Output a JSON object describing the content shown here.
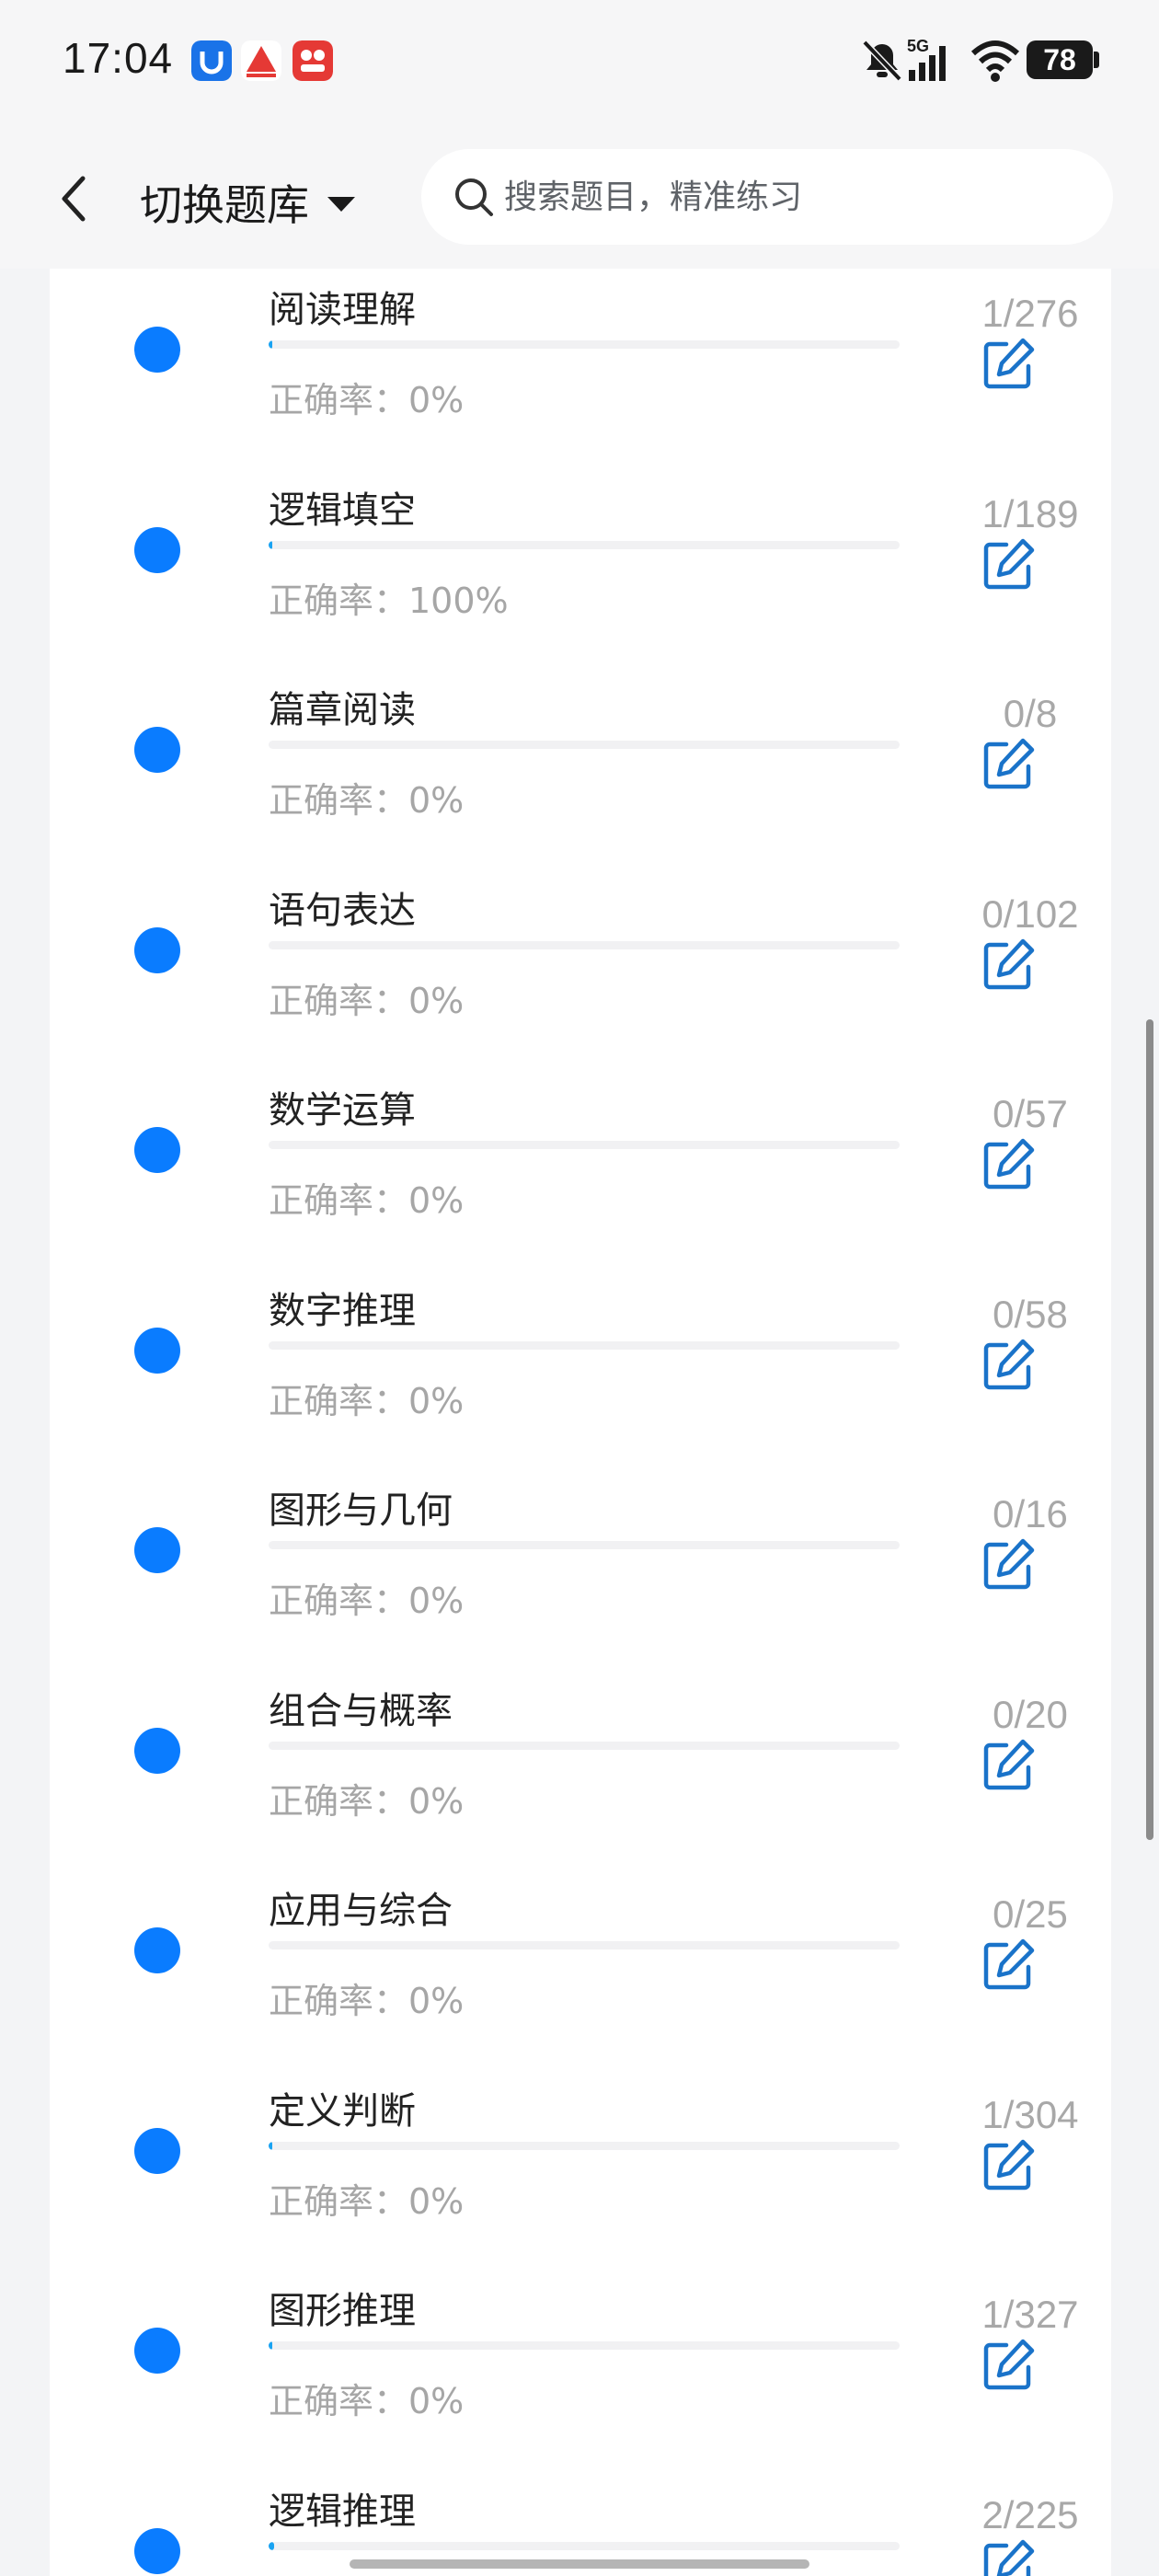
{
  "status_bar": {
    "time": "17:04",
    "network": "5G",
    "battery": "78",
    "icons": [
      "app-icon-blue",
      "app-icon-red-triangle",
      "app-icon-red-square",
      "bell-off-icon",
      "signal-icon",
      "wifi-icon"
    ]
  },
  "header": {
    "back_icon": "chevron-left-icon",
    "switch_label": "切换题库",
    "search_placeholder": "搜索题目，精准练习"
  },
  "accuracy_prefix": "正确率：",
  "colors": {
    "accent": "#0a7cff",
    "progress": "#1aa3f2",
    "edit_icon": "#1a73c9"
  },
  "items": [
    {
      "title": "阅读理解",
      "accuracy": "正确率：0%",
      "count": "1/276",
      "progress": 0.0036
    },
    {
      "title": "逻辑填空",
      "accuracy": "正确率：100%",
      "count": "1/189",
      "progress": 0.0053
    },
    {
      "title": "篇章阅读",
      "accuracy": "正确率：0%",
      "count": "0/8",
      "progress": 0
    },
    {
      "title": "语句表达",
      "accuracy": "正确率：0%",
      "count": "0/102",
      "progress": 0
    },
    {
      "title": "数学运算",
      "accuracy": "正确率：0%",
      "count": "0/57",
      "progress": 0
    },
    {
      "title": "数字推理",
      "accuracy": "正确率：0%",
      "count": "0/58",
      "progress": 0
    },
    {
      "title": "图形与几何",
      "accuracy": "正确率：0%",
      "count": "0/16",
      "progress": 0
    },
    {
      "title": "组合与概率",
      "accuracy": "正确率：0%",
      "count": "0/20",
      "progress": 0
    },
    {
      "title": "应用与综合",
      "accuracy": "正确率：0%",
      "count": "0/25",
      "progress": 0
    },
    {
      "title": "定义判断",
      "accuracy": "正确率：0%",
      "count": "1/304",
      "progress": 0.0033
    },
    {
      "title": "图形推理",
      "accuracy": "正确率：0%",
      "count": "1/327",
      "progress": 0.0031
    },
    {
      "title": "逻辑推理",
      "accuracy": "",
      "count": "2/225",
      "progress": 0.0089
    }
  ]
}
